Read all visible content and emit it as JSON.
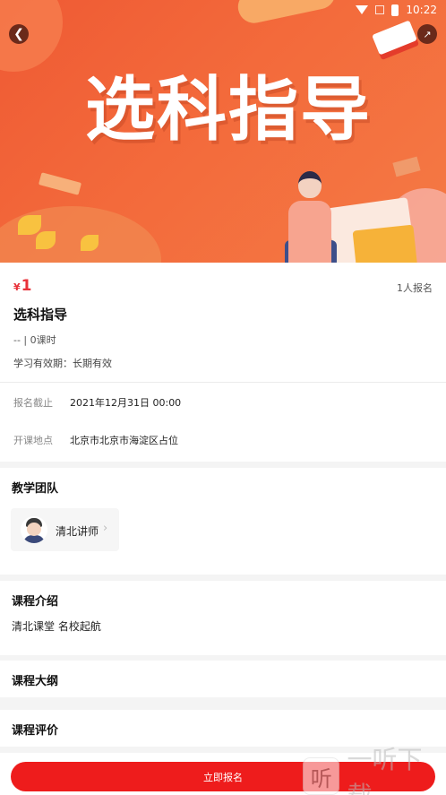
{
  "status_bar": {
    "time": "10:22"
  },
  "hero": {
    "title": "选科指导"
  },
  "course": {
    "price_symbol": "¥",
    "price": "1",
    "enroll_count": "1人报名",
    "title": "选科指导",
    "meta": "-- | 0课时",
    "validity": "学习有效期：长期有效"
  },
  "details": {
    "deadline_label": "报名截止",
    "deadline_value": "2021年12月31日 00:00",
    "location_label": "开课地点",
    "location_value": "北京市北京市海淀区占位"
  },
  "team": {
    "title": "教学团队",
    "teacher_name": "清北讲师"
  },
  "intro": {
    "title": "课程介绍",
    "text": "清北课堂 名校起航"
  },
  "outline": {
    "title": "课程大纲"
  },
  "reviews": {
    "title": "课程评价"
  },
  "cta": {
    "label": "立即报名"
  },
  "watermark": {
    "glyph": "听",
    "text": "一听下载"
  },
  "colors": {
    "accent": "#ee1c1c",
    "price": "#e8323a",
    "hero": "#ef5a34"
  },
  "icons": {
    "back": "back-arrow-icon",
    "share": "share-icon"
  }
}
